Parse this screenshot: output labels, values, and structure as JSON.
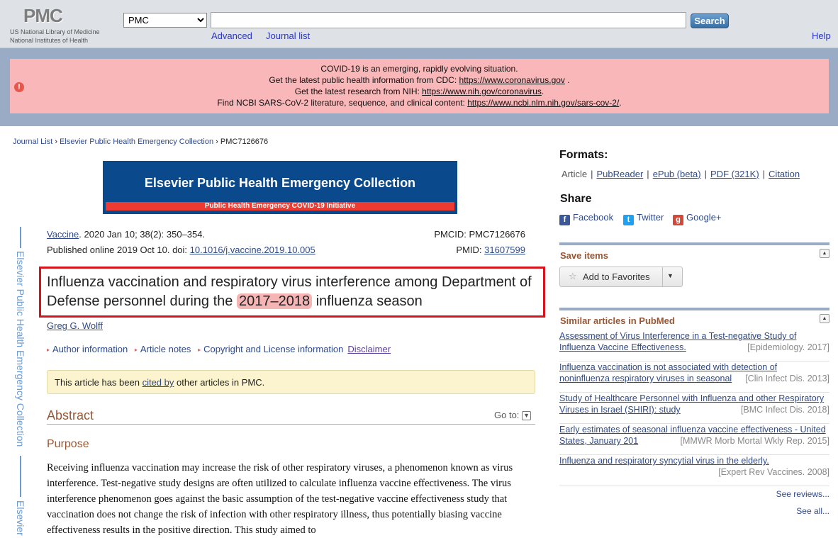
{
  "header": {
    "logo": "PMC",
    "org_line1": "US National Library of Medicine",
    "org_line2": "National Institutes of Health",
    "db_selected": "PMC",
    "search_value": "",
    "search_button": "Search",
    "advanced": "Advanced",
    "journal_list": "Journal list",
    "help": "Help"
  },
  "alert": {
    "line1": "COVID-19 is an emerging, rapidly evolving situation.",
    "line2_text": "Get the latest public health information from CDC: ",
    "line2_link": "https://www.coronavirus.gov",
    "line2_end": " .",
    "line3_text": "Get the latest research from NIH: ",
    "line3_link": "https://www.nih.gov/coronavirus",
    "line3_end": ".",
    "line4_text": "Find NCBI SARS-CoV-2 literature, sequence, and clinical content: ",
    "line4_link": "https://www.ncbi.nlm.nih.gov/sars-cov-2/",
    "line4_end": "."
  },
  "breadcrumb": {
    "item1": "Journal List",
    "item2": "Elsevier Public Health Emergency Collection",
    "current": "PMC7126676",
    "sep": " › "
  },
  "collection": {
    "title": "Elsevier Public Health Emergency Collection",
    "subtitle": "Public Health Emergency COVID-19 Initiative",
    "side_label": "Elsevier Public Health Emergency Collection",
    "side_label_2": "Elsevier"
  },
  "citation": {
    "journal": "Vaccine",
    "issue": ". 2020 Jan 10; 38(2): 350–354.",
    "published": "Published online 2019 Oct 10. doi: ",
    "doi": "10.1016/j.vaccine.2019.10.005",
    "pmcid": "PMCID: PMC7126676",
    "pmid_label": "PMID: ",
    "pmid": "31607599"
  },
  "article": {
    "title_before": "Influenza vaccination and respiratory virus interference among Department of Defense personnel during the ",
    "title_highlight": "2017–2018",
    "title_after": " influenza season",
    "author": "Greg G. Wolff",
    "meta_author": "Author information",
    "meta_notes": "Article notes",
    "meta_copyright": "Copyright and License information",
    "meta_disclaimer": "Disclaimer",
    "cited_before": "This article has been ",
    "cited_link": "cited by",
    "cited_after": " other articles in PMC.",
    "abstract_heading": "Abstract",
    "goto": "Go to:",
    "purpose_heading": "Purpose",
    "purpose_text": "Receiving influenza vaccination may increase the risk of other respiratory viruses, a phenomenon known as virus interference. Test-negative study designs are often utilized to calculate influenza vaccine effectiveness. The virus interference phenomenon goes against the basic assumption of the test-negative vaccine effectiveness study that vaccination does not change the risk of infection with other respiratory illness, thus potentially biasing vaccine effectiveness results in the positive direction. This study aimed to"
  },
  "formats": {
    "heading": "Formats:",
    "article": "Article",
    "pubreader": "PubReader",
    "epub": "ePub (beta)",
    "pdf": "PDF (321K)",
    "citation": "Citation",
    "sep": "|"
  },
  "share": {
    "heading": "Share",
    "facebook": "Facebook",
    "twitter": "Twitter",
    "googleplus": "Google+"
  },
  "save_items": {
    "heading": "Save items",
    "add_favorites": "Add to Favorites"
  },
  "similar": {
    "heading": "Similar articles in PubMed",
    "items": [
      {
        "title": "Assessment of Virus Interference in a Test-negative Study of Influenza Vaccine Effectiveness.",
        "source": "[Epidemiology. 2017]"
      },
      {
        "title": "Influenza vaccination is not associated with detection of noninfluenza respiratory viruses in seasonal",
        "source": "[Clin Infect Dis. 2013]"
      },
      {
        "title": "Study of Healthcare Personnel with Influenza and other Respiratory Viruses in Israel (SHIRI): study",
        "source": "[BMC Infect Dis. 2018]"
      },
      {
        "title": "Early estimates of seasonal influenza vaccine effectiveness - United States, January 201",
        "source": "[MMWR Morb Mortal Wkly Rep. 2015]"
      },
      {
        "title": "Influenza and respiratory syncytial virus in the elderly.",
        "source": "[Expert Rev Vaccines. 2008]"
      }
    ],
    "see_reviews": "See reviews...",
    "see_all": "See all..."
  },
  "colors": {
    "header_bg": "#dee1e5",
    "band_bg": "#9aabc5",
    "alert_bg": "#f9b7b9",
    "collection_blue": "#0a4a8c",
    "collection_red": "#ee3b31",
    "title_box_red": "#d6141c",
    "heading_brown": "#985735",
    "link_blue": "#2f4a8a"
  },
  "icons": {
    "alert": "alert-icon",
    "facebook": "facebook-icon",
    "twitter": "twitter-icon",
    "googleplus": "googleplus-icon",
    "star": "star-icon",
    "goto": "chevron-down-icon"
  }
}
